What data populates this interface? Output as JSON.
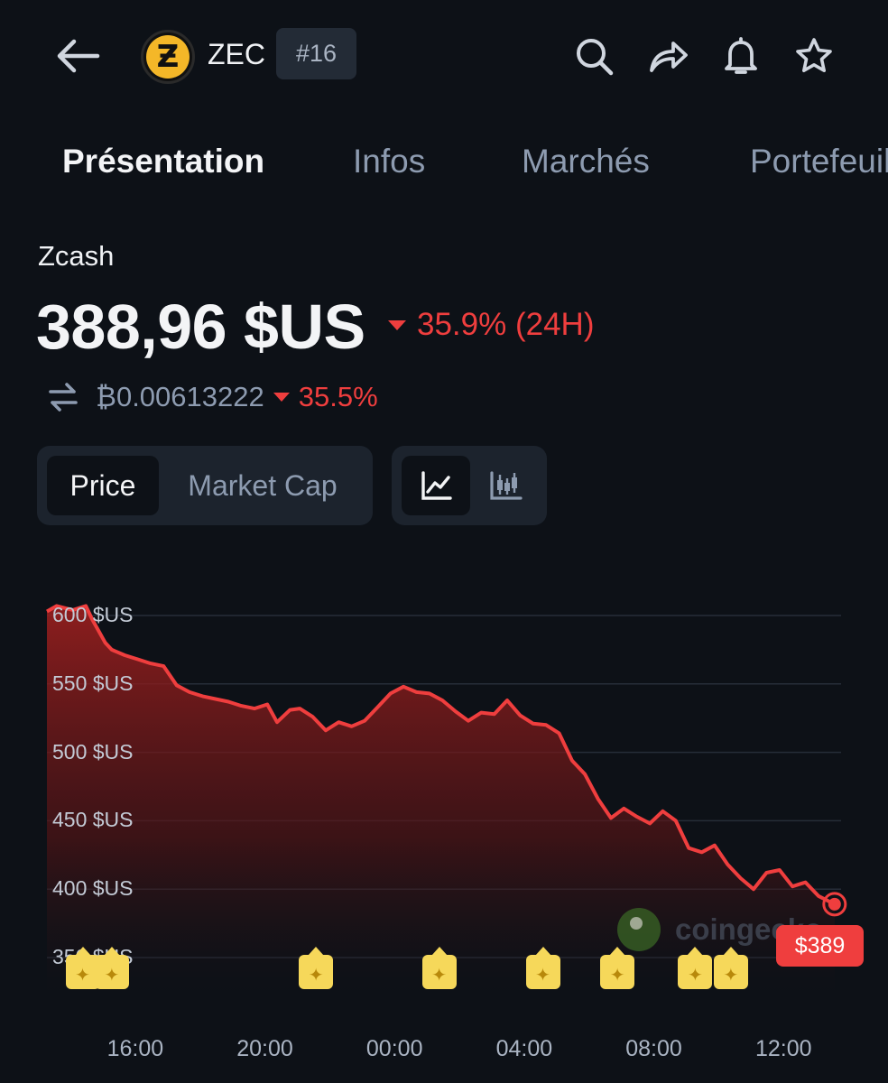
{
  "header": {
    "symbol": "ZEC",
    "rank": "#16",
    "logo_glyph": "Ƶ",
    "icons": [
      "back-arrow-icon",
      "search-icon",
      "share-icon",
      "bell-icon",
      "star-icon"
    ]
  },
  "tabs": [
    {
      "label": "Présentation",
      "active": true
    },
    {
      "label": "Infos",
      "active": false
    },
    {
      "label": "Marchés",
      "active": false
    },
    {
      "label": "Portefeuille",
      "active": false
    }
  ],
  "coin": {
    "name": "Zcash",
    "price": "388,96 $US",
    "change_24h": "35.9% (24H)",
    "btc_price": "₿0.00613222",
    "btc_change": "35.5%"
  },
  "toggles": {
    "metric_options": [
      "Price",
      "Market Cap"
    ],
    "metric_selected": "Price",
    "chart_type_icons": [
      "line-chart-icon",
      "candlestick-chart-icon"
    ],
    "chart_type_selected": "line-chart-icon"
  },
  "colors": {
    "background": "#0d1117",
    "negative": "#ef3e3e",
    "muted_text": "#8d9bb0",
    "event_marker": "#f6d85a"
  },
  "chart_data": {
    "type": "area",
    "y_tick_labels": [
      "600 $US",
      "550 $US",
      "500 $US",
      "450 $US",
      "400 $US",
      "350 $US"
    ],
    "y_ticks": [
      600,
      550,
      500,
      450,
      400,
      350
    ],
    "ylim": [
      350,
      600
    ],
    "x_tick_labels": [
      "16:00",
      "20:00",
      "00:00",
      "04:00",
      "08:00",
      "12:00"
    ],
    "x_ticks": [
      16,
      20,
      24,
      28,
      32,
      36
    ],
    "xlim": [
      13.2,
      37.7
    ],
    "grid": true,
    "series": [
      {
        "x": [
          13.2,
          13.5,
          14.0,
          14.4,
          14.6,
          15.0,
          15.2,
          15.6,
          16.0,
          16.4,
          16.8,
          17.2,
          17.6,
          18.0,
          18.4,
          18.8,
          19.2,
          19.6,
          20.0,
          20.3,
          20.7,
          21.0,
          21.4,
          21.8,
          22.2,
          22.6,
          23.0,
          23.4,
          23.8,
          24.2,
          24.6,
          25.0,
          25.4,
          25.8,
          26.2,
          26.6,
          27.0,
          27.4,
          27.8,
          28.2,
          28.6,
          29.0,
          29.4,
          29.8,
          30.2,
          30.6,
          31.0,
          31.4,
          31.8,
          32.2,
          32.6,
          33.0,
          33.4,
          33.8,
          34.2,
          34.6,
          35.0,
          35.4,
          35.8,
          36.2,
          36.6,
          37.0,
          37.5
        ],
        "y": [
          603,
          607,
          604,
          607,
          597,
          580,
          575,
          571,
          568,
          565,
          563,
          549,
          544,
          541,
          539,
          537,
          534,
          532,
          535,
          522,
          531,
          532,
          526,
          516,
          522,
          519,
          523,
          533,
          543,
          548,
          544,
          543,
          538,
          530,
          523,
          529,
          528,
          538,
          527,
          521,
          520,
          514,
          494,
          484,
          466,
          452,
          459,
          453,
          448,
          457,
          450,
          430,
          427,
          432,
          418,
          408,
          400,
          412,
          414,
          402,
          405,
          395,
          389
        ]
      }
    ],
    "last_price_label": "$389",
    "event_markers_x": [
      14.3,
      15.2,
      21.5,
      25.3,
      28.5,
      30.8,
      33.2,
      34.3
    ],
    "watermark": "coingecko"
  }
}
